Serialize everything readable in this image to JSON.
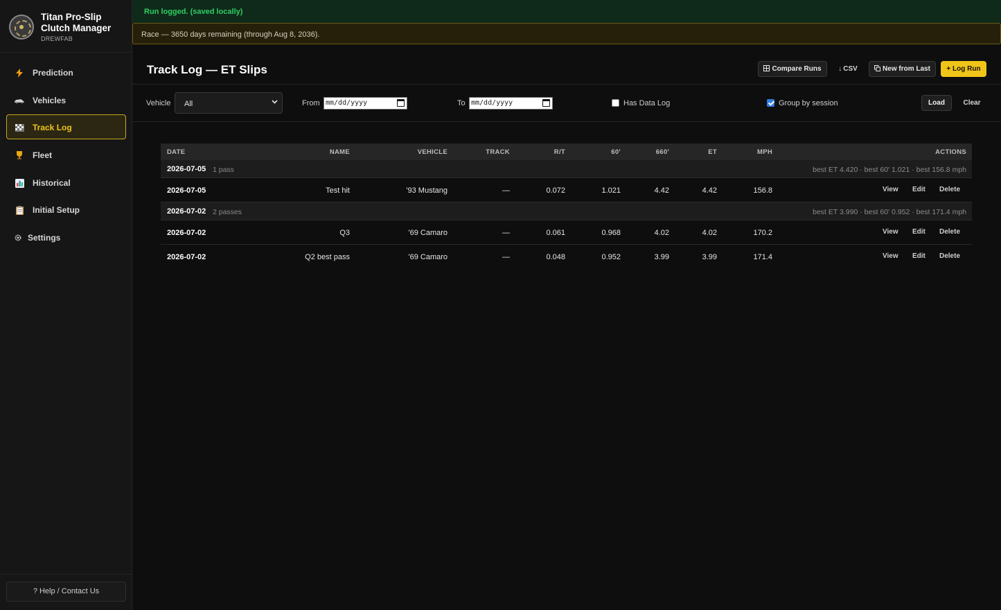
{
  "app": {
    "title": "Titan Pro-Slip Clutch Manager",
    "subtitle": "DREWFAB"
  },
  "nav": {
    "items": [
      {
        "label": "Prediction",
        "icon": "lightning-icon",
        "active": false
      },
      {
        "label": "Vehicles",
        "icon": "car-icon",
        "active": false
      },
      {
        "label": "Track Log",
        "icon": "checkered-flag-icon",
        "active": true
      },
      {
        "label": "Fleet",
        "icon": "trophy-icon",
        "active": false
      },
      {
        "label": "Historical",
        "icon": "bar-chart-icon",
        "active": false
      },
      {
        "label": "Initial Setup",
        "icon": "clipboard-icon",
        "active": false
      },
      {
        "label": "Settings",
        "icon": "gear-icon",
        "active": false
      }
    ],
    "help_label": "? Help / Contact Us"
  },
  "banners": {
    "success": "Run logged. (saved locally)",
    "notice": "Race — 3650 days remaining (through Aug 8, 2036)."
  },
  "header": {
    "title": "Track Log — ET Slips",
    "compare_label": "Compare Runs",
    "csv_label": "CSV",
    "new_from_last_label": "New from Last",
    "log_run_label": "+ Log Run"
  },
  "filters": {
    "vehicle_label": "Vehicle",
    "vehicle_value": "All",
    "from_label": "From",
    "to_label": "To",
    "date_placeholder": "mm/dd/yyyy",
    "has_data_log_label": "Has Data Log",
    "has_data_log_checked": false,
    "group_by_session_label": "Group by session",
    "group_by_session_checked": true,
    "load_label": "Load",
    "clear_label": "Clear"
  },
  "table": {
    "columns": {
      "date": "DATE",
      "name": "NAME",
      "vehicle": "VEHICLE",
      "track": "TRACK",
      "rt": "R/T",
      "sixty": "60'",
      "six60": "660'",
      "et": "ET",
      "mph": "MPH",
      "actions": "ACTIONS"
    },
    "action_labels": {
      "view": "View",
      "edit": "Edit",
      "delete": "Delete"
    },
    "groups": [
      {
        "date": "2026-07-05",
        "count": "1 pass",
        "best": "best ET 4.420 · best 60' 1.021 · best 156.8 mph",
        "rows": [
          {
            "date": "2026-07-05",
            "name": "Test hit",
            "vehicle": "'93 Mustang",
            "track": "—",
            "rt": "0.072",
            "sixty": "1.021",
            "six60": "4.42",
            "et": "4.42",
            "mph": "156.8"
          }
        ]
      },
      {
        "date": "2026-07-02",
        "count": "2 passes",
        "best": "best ET 3.990 · best 60' 0.952 · best 171.4 mph",
        "rows": [
          {
            "date": "2026-07-02",
            "name": "Q3",
            "vehicle": "'69 Camaro",
            "track": "—",
            "rt": "0.061",
            "sixty": "0.968",
            "six60": "4.02",
            "et": "4.02",
            "mph": "170.2"
          },
          {
            "date": "2026-07-02",
            "name": "Q2 best pass",
            "vehicle": "'69 Camaro",
            "track": "—",
            "rt": "0.048",
            "sixty": "0.952",
            "six60": "3.99",
            "et": "3.99",
            "mph": "171.4"
          }
        ]
      }
    ]
  },
  "colors": {
    "accent": "#f0c419",
    "success": "#2fcf62",
    "background": "#0e0e0e",
    "sidebar": "#161616"
  }
}
